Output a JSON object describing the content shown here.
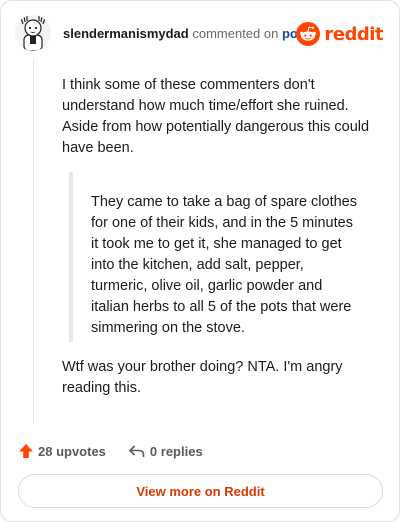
{
  "header": {
    "username": "slendermanismydad",
    "commented_text": "commented on",
    "post_link": "post",
    "brand": "reddit"
  },
  "comment": {
    "paragraph_1": "I think some of these commenters don't understand how much time/effort she ruined. Aside from how potentially dangerous this could have been.",
    "quote": "They came to take a bag of spare clothes for one of their kids, and in the 5 minutes it took me to get it, she managed to get into the kitchen, add salt, pepper, turmeric, olive oil, garlic powder and italian herbs to all 5 of the pots that were simmering on the stove.",
    "paragraph_2": "Wtf was your brother doing? NTA. I'm angry reading this."
  },
  "actions": {
    "upvotes": "28 upvotes",
    "replies": "0 replies"
  },
  "view_more": "View more on Reddit",
  "colors": {
    "brand": "#ff4500",
    "link": "#0a4d9c",
    "upvote": "#ff4500",
    "view_more_text": "#d93900"
  },
  "icons": [
    "snoo-avatar-icon",
    "reddit-logo-icon",
    "upvote-arrow-icon",
    "reply-icon"
  ]
}
